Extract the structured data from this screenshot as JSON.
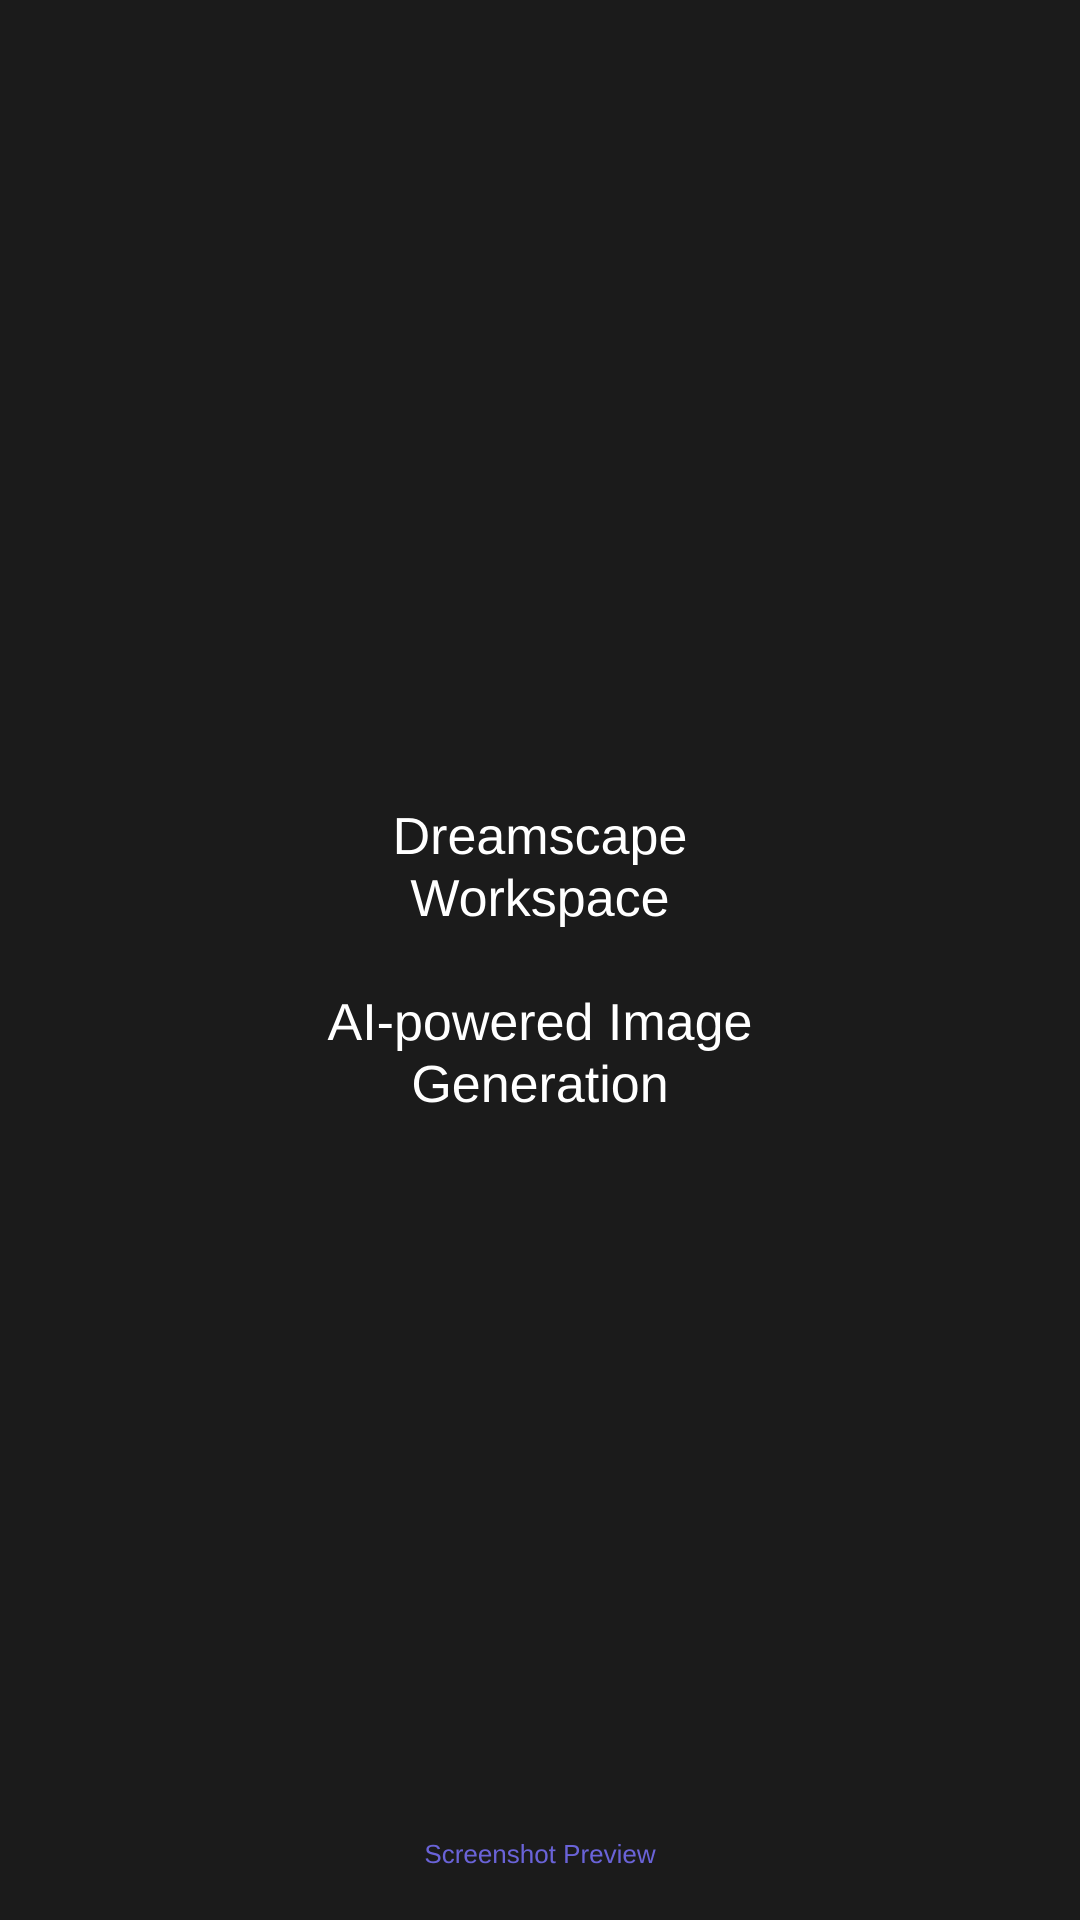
{
  "splash": {
    "title_line1": "Dreamscape",
    "title_line2": "Workspace",
    "subtitle_line1": "AI-powered Image",
    "subtitle_line2": "Generation"
  },
  "footer": {
    "link_label": "Screenshot Preview"
  },
  "colors": {
    "background": "#1b1b1b",
    "text": "#ffffff",
    "accent": "#6a63d8"
  }
}
